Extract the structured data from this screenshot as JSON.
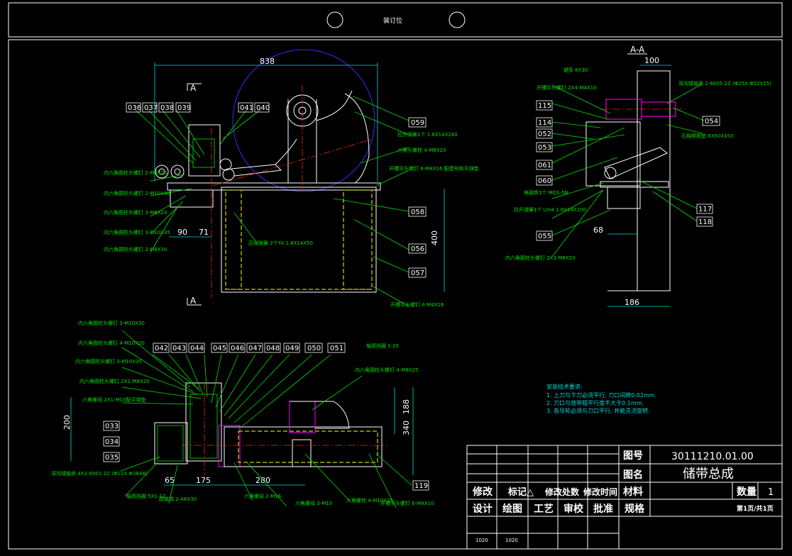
{
  "header": {
    "binding_label": "装订位"
  },
  "section_labels": {
    "top": "A",
    "bottom": "A",
    "section_view": "A-A"
  },
  "dims": {
    "d838": "838",
    "d90": "90",
    "d71": "71",
    "d400": "400",
    "d100": "100",
    "d68": "68",
    "d186": "186",
    "d200": "200",
    "d188": "188",
    "d340": "340",
    "d65": "65",
    "d175": "175",
    "d280": "280"
  },
  "balloons_main": [
    "036",
    "037",
    "038",
    "039",
    "041",
    "040",
    "059",
    "058",
    "056",
    "057"
  ],
  "balloons_side": [
    "115",
    "114",
    "052",
    "053",
    "061",
    "060",
    "055",
    "054",
    "117",
    "118"
  ],
  "balloons_bottom": [
    "042",
    "043",
    "044",
    "045",
    "046",
    "047",
    "048",
    "049",
    "050",
    "051",
    "033",
    "034",
    "035",
    "119"
  ],
  "callouts_main": [
    "内六角圆柱头螺钉 2-M8X25",
    "内六角圆柱头螺钉 2-M10X40",
    "内六角圆柱头螺钉 3-M8X20",
    "内六角圆柱头螺钉 3-M10X35",
    "内六角圆柱头螺钉 2-M8X30",
    "拉升弹簧1个 1.6X14X240",
    "六角头螺栓 4-M8X20",
    "开槽平头螺钉 6-M4X16 配建号和平弹垫",
    "压缩弹簧 2个YA 1.8X14X50",
    "开槽平头螺钉 4-M4X16"
  ],
  "callouts_side": [
    "键条 6X30",
    "开槽平头螺钉 2X4-M4X10",
    "深沟球轴承 2-6005-2Z (Φ25X Φ52X15)",
    "石棉摩擦垫 6X50X150",
    "电磁铁1个 MQ1-5N",
    "拉升弹簧1个 Lm4 1.6X14X100",
    "内六角圆柱头螺钉 2X3-M8X20"
  ],
  "callouts_bottom": [
    "内六角圆柱头螺钉 3-M10X30",
    "内六角圆柱头螺钉 4-M10X20",
    "内六角圆柱头螺钉 3-M10X35",
    "内六角圆柱头螺钉 2X1-M8X20",
    "六角螺母 2X1-M10配平弹垫",
    "轴用挡圈 1-25",
    "内六角圆柱头螺钉 4-M8X25",
    "深沟球轴承 4X2-6001-2Z (Φ12X Φ28X8)",
    "轴用挡圈 5X1-12",
    "圆锥销 2-A6X30",
    "六角螺母 2-M16",
    "六角螺母 3-M10",
    "六角螺栓 4-M10X25",
    "开槽平头螺钉 6-M4X10"
  ],
  "tech_notes": {
    "title": "安装技术要求:",
    "lines": [
      "1. 上刀与下刀必须平行, 刀口间隙0.02mm.",
      "2. 刀口与放带辊平行度不大于0.1mm.",
      "3. 各导轮必须与刀口平行, 并能灵活旋转."
    ]
  },
  "title_block": {
    "drawing_no_label": "图号",
    "drawing_no": "30111210.01.00",
    "name_label": "图名",
    "name": "储带总成",
    "revise": "修改",
    "mark": "标记△",
    "revise_place": "修改处数",
    "revise_time": "修改时间",
    "material_label": "材料",
    "qty_label": "数量",
    "qty": "1",
    "design": "设计",
    "drawn": "绘图",
    "process": "工艺",
    "check": "审校",
    "approve": "批准",
    "spec": "规格",
    "sheet": "第1页/共1页",
    "date1": "1020",
    "date2": "1020"
  }
}
